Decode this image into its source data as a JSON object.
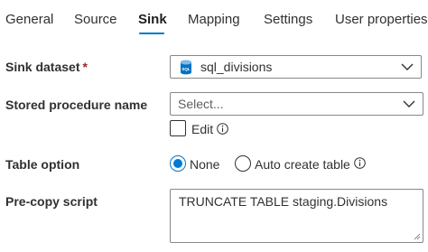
{
  "tabs": [
    {
      "label": "General",
      "active": false
    },
    {
      "label": "Source",
      "active": false
    },
    {
      "label": "Sink",
      "active": true
    },
    {
      "label": "Mapping",
      "active": false
    },
    {
      "label": "Settings",
      "active": false
    },
    {
      "label": "User properties",
      "active": false
    }
  ],
  "sink_dataset": {
    "label": "Sink dataset",
    "required_mark": "*",
    "value": "sql_divisions",
    "icon": "sql-database-icon"
  },
  "stored_procedure": {
    "label": "Stored procedure name",
    "placeholder": "Select...",
    "edit_label": "Edit",
    "edit_checked": false
  },
  "table_option": {
    "label": "Table option",
    "options": [
      {
        "label": "None",
        "selected": true
      },
      {
        "label": "Auto create table",
        "selected": false
      }
    ]
  },
  "pre_copy_script": {
    "label": "Pre-copy script",
    "value": "TRUNCATE TABLE staging.Divisions"
  },
  "colors": {
    "accent": "#0078d4",
    "required": "#a4262c",
    "text": "#323130",
    "border": "#8a8886"
  }
}
